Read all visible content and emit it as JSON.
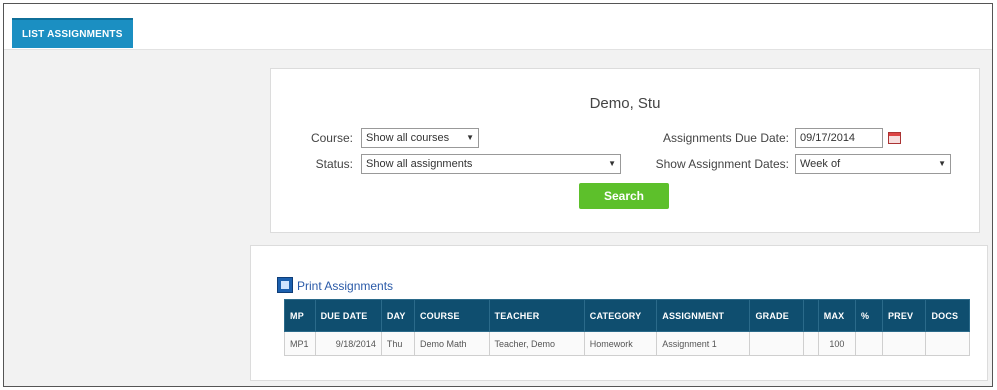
{
  "tab": {
    "label": "LIST ASSIGNMENTS"
  },
  "student": {
    "name": "Demo, Stu"
  },
  "filters": {
    "course_label": "Course:",
    "course_value": "Show all courses",
    "status_label": "Status:",
    "status_value": "Show all assignments",
    "due_date_label": "Assignments Due Date:",
    "due_date_value": "09/17/2014",
    "show_dates_label": "Show Assignment Dates:",
    "show_dates_value": "Week of"
  },
  "search_button": "Search",
  "print_link": "Print Assignments",
  "table": {
    "headers": [
      "MP",
      "DUE DATE",
      "DAY",
      "COURSE",
      "TEACHER",
      "CATEGORY",
      "ASSIGNMENT",
      "GRADE",
      "",
      "MAX",
      "%",
      "PREV",
      "DOCS"
    ],
    "rows": [
      [
        "MP1",
        "9/18/2014",
        "Thu",
        "Demo Math",
        "Teacher, Demo",
        "Homework",
        "Assignment 1",
        "",
        "",
        "100",
        "",
        "",
        ""
      ]
    ]
  },
  "colors": {
    "tab": "#1b8fc2",
    "header": "#0f4e6f",
    "search_button": "#5dc02b",
    "link": "#2a5aa8"
  },
  "icons": {
    "print": "print-icon",
    "calendar": "calendar-icon",
    "dropdown": "chevron-down-icon"
  }
}
